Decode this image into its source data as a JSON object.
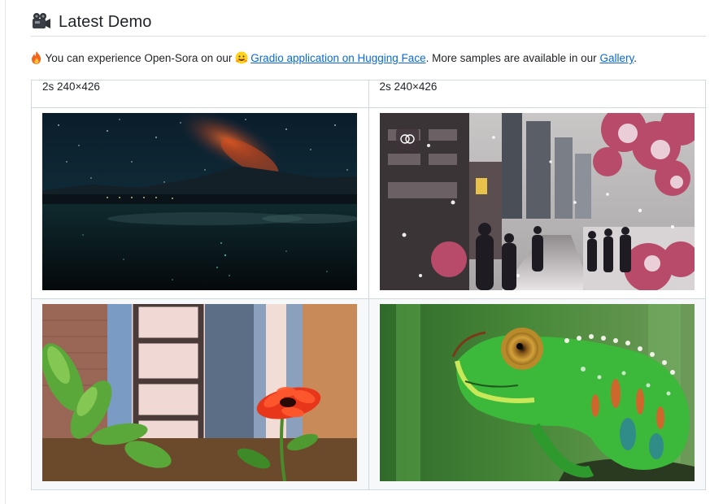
{
  "section": {
    "icon": "movie-camera-icon",
    "title": "Latest Demo"
  },
  "intro": {
    "lead_icon": "fire-icon",
    "text_before": "You can experience Open-Sora on our ",
    "link1_icon": "hugging-face-icon",
    "link1_label": "Gradio application on Hugging Face",
    "text_middle": ". More samples are available in our ",
    "link2_label": "Gallery",
    "text_after": "."
  },
  "table": {
    "headers": [
      "2s 240×426",
      "2s 240×426"
    ],
    "rows": [
      [
        {
          "media": "video-thumbnail",
          "subject": "starry night sky over lake"
        },
        {
          "media": "video-thumbnail",
          "subject": "snowy city street with cherry blossoms"
        }
      ],
      [
        {
          "media": "video-thumbnail",
          "subject": "red flower by a window"
        },
        {
          "media": "video-thumbnail",
          "subject": "green chameleon"
        }
      ]
    ]
  },
  "colors": {
    "link": "#0969da",
    "border": "#d1d9e0",
    "alt_row": "#f6f8fa"
  }
}
